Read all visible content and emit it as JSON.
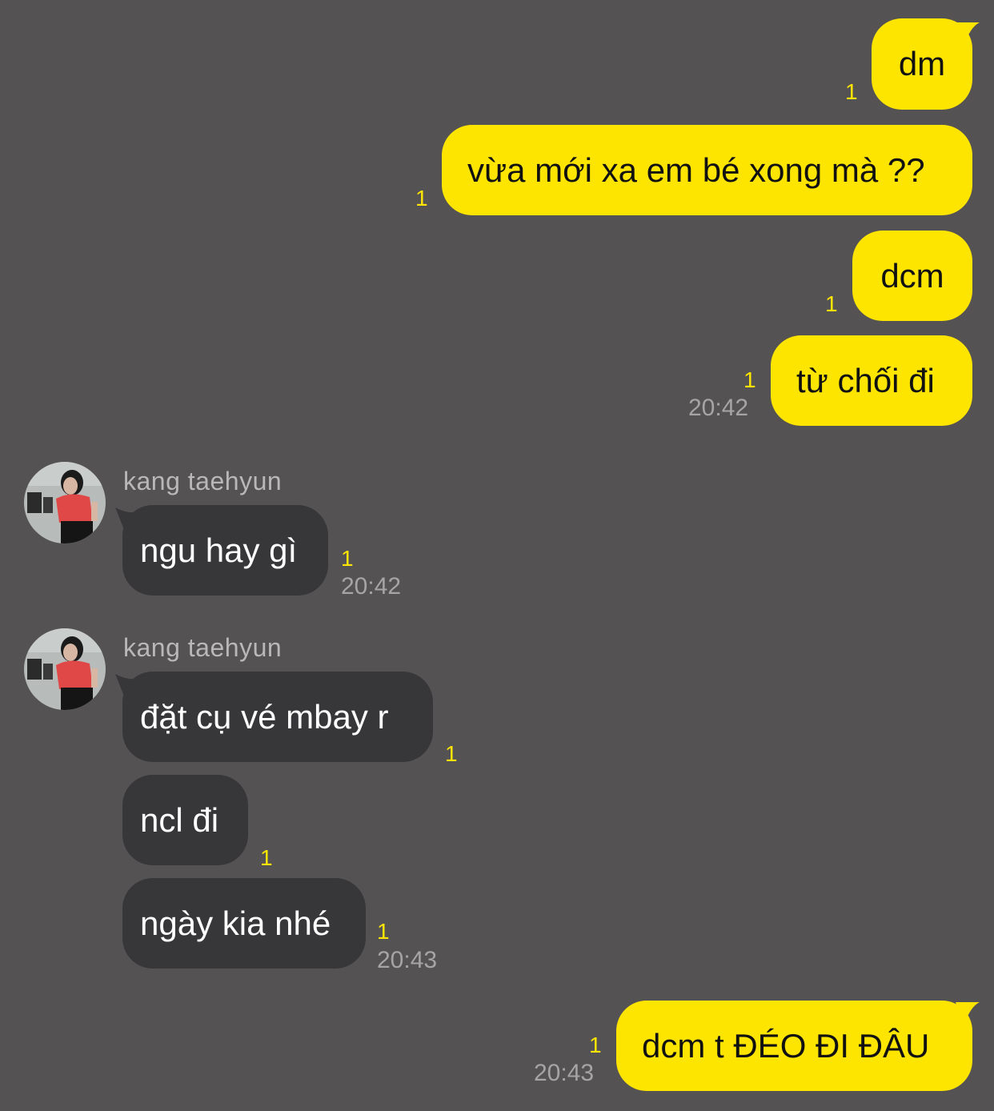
{
  "colors": {
    "background": "#545253",
    "my_bubble": "#fee500",
    "their_bubble": "#373638",
    "unread_count": "#fee500",
    "timestamp": "#a6a5a6"
  },
  "messages": [
    {
      "from": "me",
      "text": "dm",
      "unread": "1"
    },
    {
      "from": "me",
      "text": "vừa mới xa em bé xong mà ??",
      "unread": "1"
    },
    {
      "from": "me",
      "text": "dcm",
      "unread": "1"
    },
    {
      "from": "me",
      "text": "từ chối đi",
      "unread": "1",
      "time": "20:42"
    },
    {
      "from": "kang taehyun",
      "sender": "kang taehyun",
      "avatar": "profile-photo",
      "text": "ngu hay gì",
      "unread": "1",
      "time": "20:42"
    },
    {
      "from": "kang taehyun",
      "sender": "kang taehyun",
      "avatar": "profile-photo",
      "text": "đặt cụ vé mbay r",
      "unread": "1"
    },
    {
      "from": "kang taehyun",
      "text": "ncl đi",
      "unread": "1"
    },
    {
      "from": "kang taehyun",
      "text": "ngày kia nhé",
      "unread": "1",
      "time": "20:43"
    },
    {
      "from": "me",
      "text": "dcm t ĐÉO ĐI ĐÂU",
      "unread": "1",
      "time": "20:43"
    }
  ]
}
